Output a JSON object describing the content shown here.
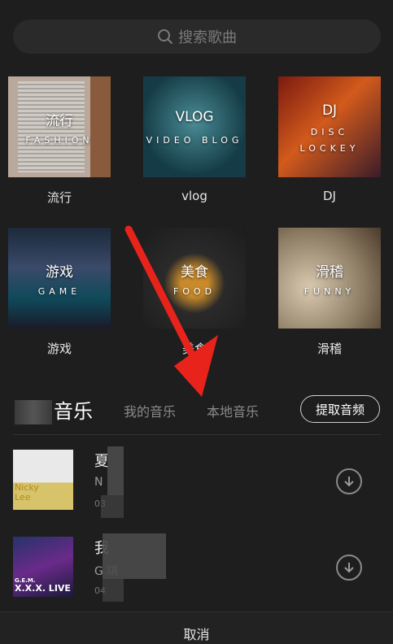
{
  "search": {
    "placeholder": "搜索歌曲"
  },
  "categories": [
    {
      "title": "流行",
      "sub": "FASHION",
      "sub2": "",
      "label": "流行"
    },
    {
      "title": "VLOG",
      "sub": "VIDEO BLOG",
      "sub2": "",
      "label": "vlog"
    },
    {
      "title": "DJ",
      "sub": "DISC",
      "sub2": "LOCKEY",
      "label": "DJ"
    },
    {
      "title": "游戏",
      "sub": "GAME",
      "sub2": "",
      "label": "游戏"
    },
    {
      "title": "美食",
      "sub": "FOOD",
      "sub2": "",
      "label": "美食"
    },
    {
      "title": "滑稽",
      "sub": "FUNNY",
      "sub2": "",
      "label": "滑稽"
    }
  ],
  "tabs": {
    "main_suffix": "音乐",
    "mine": "我的音乐",
    "local": "本地音乐",
    "extract": "提取音频"
  },
  "songs": [
    {
      "name": "夏",
      "artist": "N",
      "duration": "03",
      "cover_top": "Nicky",
      "cover_bottom": "Lee"
    },
    {
      "name": "我",
      "artist": "G                    琪",
      "duration": "04",
      "cover_top": "G.E.M.",
      "cover_bottom": "X.X.X. LIVE"
    }
  ],
  "footer": {
    "cancel": "取消"
  },
  "colors": {
    "background": "#1e1e1e",
    "arrow": "#e8231c"
  }
}
